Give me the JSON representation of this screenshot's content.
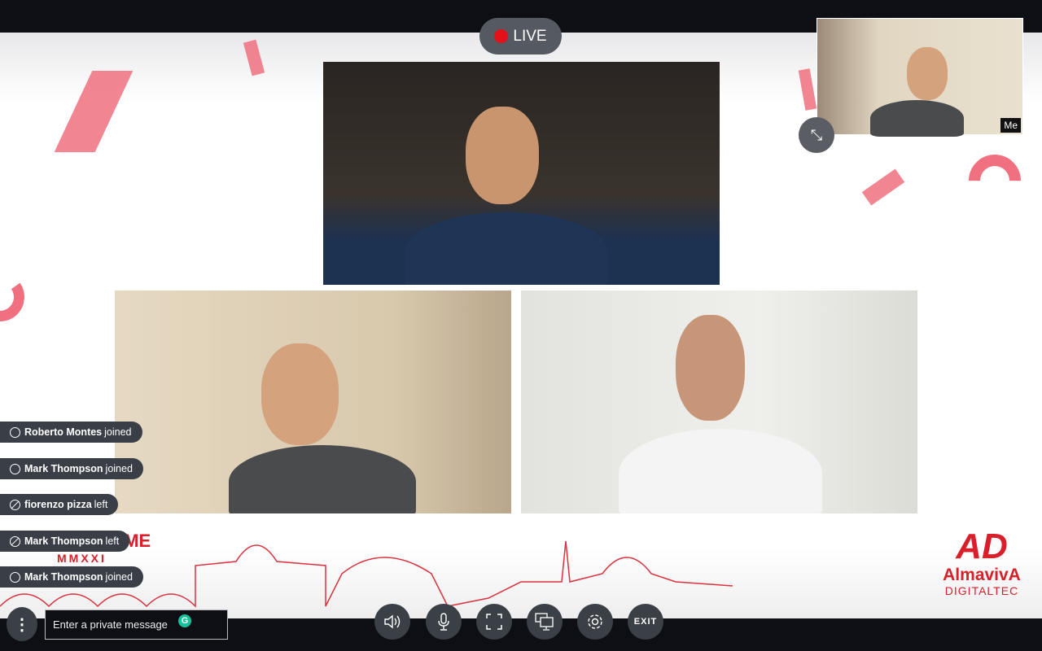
{
  "live": {
    "label": "LIVE",
    "color": "#e4101a"
  },
  "self_view": {
    "label": "Me",
    "icon": "shrink-icon"
  },
  "notifications": [
    {
      "name": "Roberto Montes",
      "action": "joined",
      "icon": "circle-icon"
    },
    {
      "name": "Mark Thompson",
      "action": "joined",
      "icon": "circle-icon"
    },
    {
      "name": "fiorenzo pizza",
      "action": "left",
      "icon": "slash-circle-icon"
    },
    {
      "name": "Mark Thompson",
      "action": "left",
      "icon": "slash-circle-icon"
    },
    {
      "name": "Mark Thompson",
      "action": "joined",
      "icon": "circle-icon"
    }
  ],
  "event_logo": {
    "line1": "NG ROME",
    "line2": "MMXXI"
  },
  "brand": {
    "mark": "AD",
    "name": "AlmavivA",
    "sub": "DIGITALTEC",
    "color": "#d91f2a"
  },
  "chat": {
    "placeholder": "Enter a private message"
  },
  "controls": {
    "volume": "volume-icon",
    "mic": "microphone-icon",
    "fullscreen": "fullscreen-icon",
    "screen": "screen-share-icon",
    "settings": "settings-icon",
    "exit": "EXIT"
  }
}
